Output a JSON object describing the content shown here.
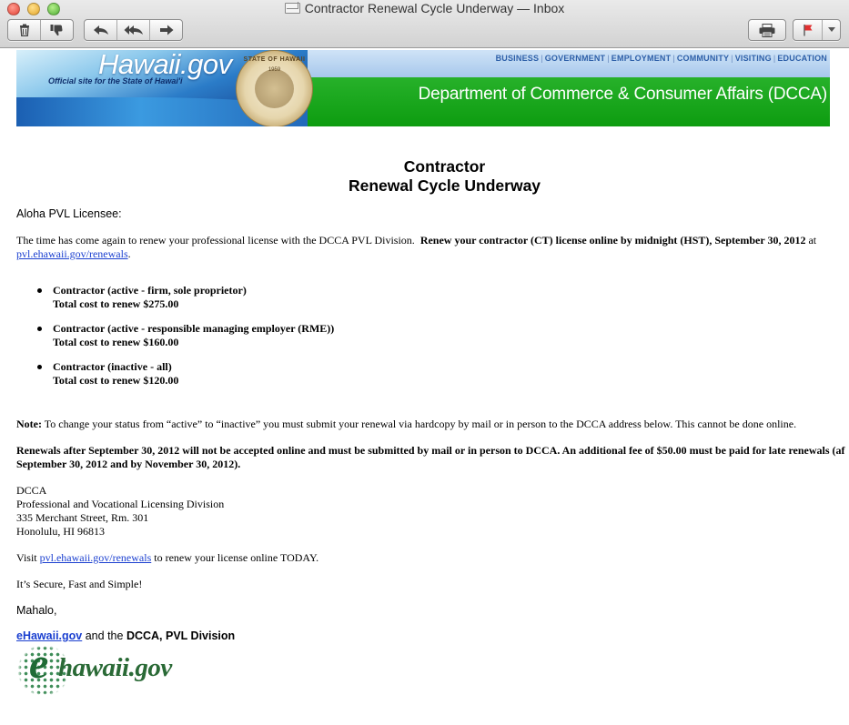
{
  "window": {
    "title": "Contractor Renewal Cycle Underway — Inbox"
  },
  "toolbar": {
    "delete_icon": "trash-icon",
    "junk_icon": "thumbs-down-icon",
    "reply_icon": "reply-icon",
    "reply_all_icon": "reply-all-icon",
    "forward_icon": "forward-icon",
    "print_icon": "printer-icon",
    "flag_icon": "flag-icon",
    "flag_color": "#e03030"
  },
  "banner": {
    "site": "Hawaii.gov",
    "tagline": "Official site for the State of Hawai'i",
    "nav": [
      "BUSINESS",
      "GOVERNMENT",
      "EMPLOYMENT",
      "COMMUNITY",
      "VISITING",
      "EDUCATION"
    ],
    "department": "Department of Commerce & Consumer Affairs (DCCA)",
    "seal_text": "STATE OF HAWAII",
    "seal_year": "1959"
  },
  "email": {
    "heading_line1": "Contractor",
    "heading_line2": "Renewal Cycle Underway",
    "greeting": "Aloha PVL Licensee:",
    "intro_plain": "The time has come again to renew your professional license with the DCCA PVL Division.",
    "intro_bold": "Renew your contractor (CT) license online by midnight (HST), September 30, 2012",
    "intro_at": "at",
    "link": "pvl.ehawaii.gov/renewals",
    "period": ".",
    "items": [
      {
        "title": "Contractor (active - firm, sole proprietor)",
        "cost": "Total cost to renew $275.00"
      },
      {
        "title": "Contractor (active - responsible managing employer (RME))",
        "cost": "Total cost to renew $160.00"
      },
      {
        "title": "Contractor (inactive - all)",
        "cost": "Total cost to renew $120.00"
      }
    ],
    "note_label": "Note:",
    "note_text": "To change your status from “active” to “inactive” you must submit your renewal via hardcopy by mail or in person to the DCCA address below. This cannot be done online.",
    "late_line1": "Renewals after September 30, 2012 will not be accepted online and must be submitted by mail or in person to DCCA.  An additional fee of $50.00 must be paid for late renewals (af",
    "late_line2": "September 30, 2012 and by November 30, 2012).",
    "address": [
      "DCCA",
      "Professional and Vocational Licensing Division",
      "335 Merchant Street, Rm. 301",
      "Honolulu, HI 96813"
    ],
    "visit_pre": "Visit",
    "visit_post": "to renew your license online TODAY.",
    "secure": "It’s Secure, Fast and Simple!",
    "mahalo": "Mahalo,",
    "sig_link": "eHawaii.gov",
    "sig_mid": "and the",
    "sig_bold": "DCCA, PVL Division",
    "logo_e": "e",
    "logo_word": "hawaii.gov"
  }
}
